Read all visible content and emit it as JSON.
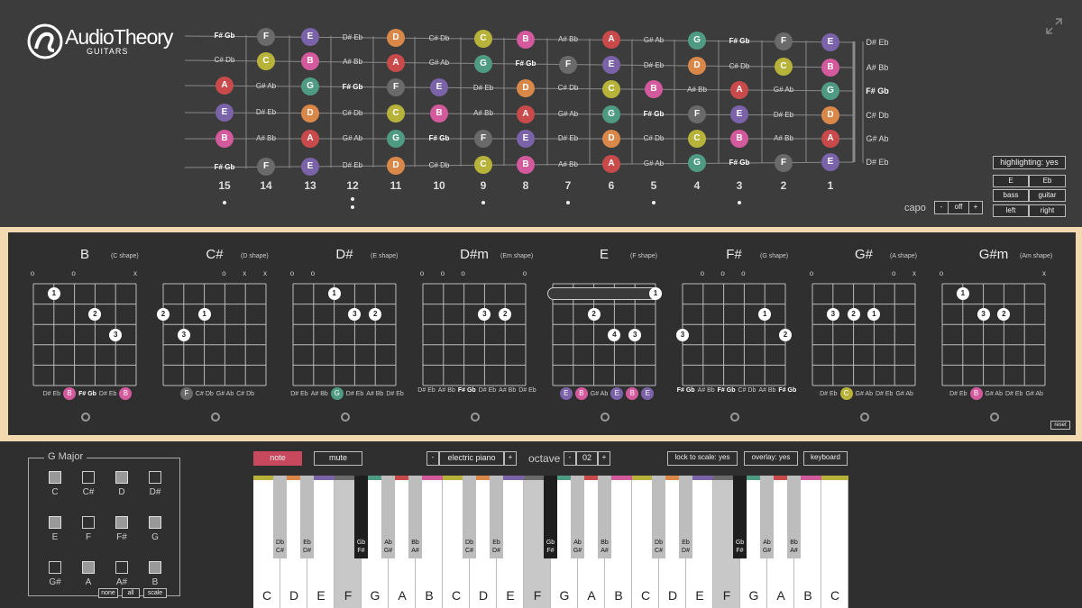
{
  "brand": {
    "name": "AudioTheory",
    "sub": "GUITARS"
  },
  "colors": {
    "A": "#c84a4a",
    "B": "#d35a9c",
    "C": "#b7b33a",
    "D": "#d9884a",
    "E": "#7a63a8",
    "F": "#6a6a6a",
    "G": "#4f9a82",
    "accent": "#f3d9b0",
    "note_button": "#c8485e"
  },
  "fretboard": {
    "fret_numbers": [
      "15",
      "14",
      "13",
      "12",
      "11",
      "10",
      "9",
      "8",
      "7",
      "6",
      "5",
      "4",
      "3",
      "2",
      "1"
    ],
    "right_labels": [
      "D# Eb",
      "A# Bb",
      "F# Gb",
      "C# Db",
      "G# Ab",
      "D# Eb"
    ],
    "strings": [
      [
        "F# Gb",
        "F",
        "E",
        "D# Eb",
        "D",
        "C# Db",
        "C",
        "B",
        "A# Bb",
        "A",
        "G# Ab",
        "G",
        "F# Gb",
        "F",
        "E"
      ],
      [
        "C# Db",
        "C",
        "B",
        "A# Bb",
        "A",
        "G# Ab",
        "G",
        "F# Gb",
        "F",
        "E",
        "D# Eb",
        "D",
        "C# Db",
        "C",
        "B"
      ],
      [
        "A",
        "G# Ab",
        "G",
        "F# Gb",
        "F",
        "E",
        "D# Eb",
        "D",
        "C# Db",
        "C",
        "B",
        "A# Bb",
        "A",
        "G# Ab",
        "G"
      ],
      [
        "E",
        "D# Eb",
        "D",
        "C# Db",
        "C",
        "B",
        "A# Bb",
        "A",
        "G# Ab",
        "G",
        "F# Gb",
        "F",
        "E",
        "D# Eb",
        "D"
      ],
      [
        "B",
        "A# Bb",
        "A",
        "G# Ab",
        "G",
        "F# Gb",
        "F",
        "E",
        "D# Eb",
        "D",
        "C# Db",
        "C",
        "B",
        "A# Bb",
        "A"
      ],
      [
        "F# Gb",
        "F",
        "E",
        "D# Eb",
        "D",
        "C# Db",
        "C",
        "B",
        "A# Bb",
        "A",
        "G# Ab",
        "G",
        "F# Gb",
        "F",
        "E"
      ]
    ]
  },
  "settings": {
    "highlighting": "highlighting: yes",
    "tuning_a": "E",
    "tuning_b": "Eb",
    "bass": "bass",
    "guitar": "guitar",
    "left": "left",
    "right": "right",
    "capo_label": "capo",
    "capo_minus": "-",
    "capo_value": "off",
    "capo_plus": "+"
  },
  "chords": [
    {
      "name": "B",
      "shape": "(C shape)",
      "open": [
        "o",
        "",
        "o",
        "",
        "",
        "x"
      ],
      "fingers": [
        [
          1,
          1,
          1
        ],
        [
          3,
          2,
          2
        ],
        [
          4,
          3,
          3
        ]
      ],
      "notes": [
        "D# Eb",
        "B",
        "F# Gb",
        "D# Eb",
        "B"
      ],
      "note_colors": [
        "",
        "B",
        "",
        "",
        "B"
      ]
    },
    {
      "name": "C#",
      "shape": "(D shape)",
      "open": [
        "",
        "",
        "",
        "o",
        "x",
        "x"
      ],
      "fingers": [
        [
          0,
          2,
          2
        ],
        [
          2,
          2,
          1
        ],
        [
          1,
          3,
          3
        ]
      ],
      "notes": [
        "F",
        "C# Db",
        "G# Ab",
        "C# Db"
      ],
      "note_colors": [
        "F",
        "",
        "",
        ""
      ]
    },
    {
      "name": "D#",
      "shape": "(E shape)",
      "open": [
        "o",
        "o",
        "",
        "",
        "",
        ""
      ],
      "fingers": [
        [
          2,
          1,
          1
        ],
        [
          3,
          2,
          3
        ],
        [
          4,
          2,
          2
        ]
      ],
      "notes": [
        "D# Eb",
        "A# Bb",
        "G",
        "D# Eb",
        "A# Bb",
        "D# Eb"
      ],
      "note_colors": [
        "",
        "",
        "G",
        "",
        "",
        ""
      ]
    },
    {
      "name": "D#m",
      "shape": "(Em shape)",
      "open": [
        "o",
        "o",
        "o",
        "",
        "",
        "o"
      ],
      "fingers": [
        [
          3,
          2,
          3
        ],
        [
          4,
          2,
          2
        ]
      ],
      "notes": [
        "D# Eb",
        "A# Bb",
        "F# Gb",
        "D# Eb",
        "A# Bb",
        "D# Eb"
      ],
      "note_colors": [
        "",
        "",
        "",
        "",
        "",
        ""
      ]
    },
    {
      "name": "E",
      "shape": "(F shape)",
      "open": [
        "",
        "",
        "",
        "",
        "",
        ""
      ],
      "fingers": [
        [
          5,
          1,
          1
        ],
        [
          2,
          2,
          2
        ],
        [
          3,
          3,
          4
        ],
        [
          4,
          3,
          3
        ]
      ],
      "notes": [
        "E",
        "B",
        "G# Ab",
        "E",
        "B",
        "E"
      ],
      "note_colors": [
        "E",
        "B",
        "",
        "E",
        "B",
        "E"
      ]
    },
    {
      "name": "F#",
      "shape": "(G shape)",
      "open": [
        "",
        "o",
        "o",
        "o",
        "",
        ""
      ],
      "fingers": [
        [
          4,
          2,
          1
        ],
        [
          0,
          3,
          3
        ],
        [
          5,
          3,
          2
        ]
      ],
      "notes": [
        "F# Gb",
        "A# Bb",
        "F# Gb",
        "C# Db",
        "A# Bb",
        "F# Gb"
      ],
      "note_colors": [
        "",
        "",
        "",
        "",
        "",
        ""
      ]
    },
    {
      "name": "G#",
      "shape": "(A shape)",
      "open": [
        "o",
        "",
        "",
        "",
        "o",
        "x"
      ],
      "fingers": [
        [
          1,
          2,
          3
        ],
        [
          2,
          2,
          2
        ],
        [
          3,
          2,
          1
        ]
      ],
      "notes": [
        "D# Eb",
        "C",
        "G# Ab",
        "D# Eb",
        "G# Ab"
      ],
      "note_colors": [
        "",
        "C",
        "",
        "",
        ""
      ]
    },
    {
      "name": "G#m",
      "shape": "(Am shape)",
      "open": [
        "o",
        "",
        "",
        "",
        "",
        "x"
      ],
      "fingers": [
        [
          1,
          1,
          1
        ],
        [
          2,
          2,
          3
        ],
        [
          3,
          2,
          2
        ]
      ],
      "notes": [
        "D# Eb",
        "B",
        "G# Ab",
        "D# Eb",
        "G# Ab"
      ],
      "note_colors": [
        "",
        "B",
        "",
        "",
        ""
      ]
    }
  ],
  "reset": "reset",
  "scale": {
    "title": "G Major",
    "notes": [
      {
        "n": "C",
        "on": true
      },
      {
        "n": "C#",
        "on": false
      },
      {
        "n": "D",
        "on": true
      },
      {
        "n": "D#",
        "on": false
      },
      {
        "n": "E",
        "on": true
      },
      {
        "n": "F",
        "on": false
      },
      {
        "n": "F#",
        "on": true
      },
      {
        "n": "G",
        "on": true
      },
      {
        "n": "G#",
        "on": false
      },
      {
        "n": "A",
        "on": true
      },
      {
        "n": "A#",
        "on": false
      },
      {
        "n": "B",
        "on": true
      }
    ],
    "none": "none",
    "all": "all",
    "scale_btn": "scale"
  },
  "keyboard_bar": {
    "note": "note",
    "mute": "mute",
    "inst_minus": "-",
    "instrument": "electric piano",
    "inst_plus": "+",
    "octave_label": "octave",
    "oct_minus": "-",
    "octave": "02",
    "oct_plus": "+",
    "lock": "lock to scale: yes",
    "overlay": "overlay: yes",
    "keyboard": "keyboard"
  },
  "piano": {
    "white": [
      "C",
      "D",
      "E",
      "F",
      "G",
      "A",
      "B",
      "C",
      "D",
      "E",
      "F",
      "G",
      "A",
      "B",
      "C",
      "D",
      "E",
      "F",
      "G",
      "A",
      "B",
      "C"
    ],
    "white_hl": [
      3,
      10,
      17
    ],
    "black": [
      [
        "Db",
        "C#"
      ],
      [
        "Eb",
        "D#"
      ],
      [
        "Gb",
        "F#"
      ],
      [
        "Ab",
        "G#"
      ],
      [
        "Bb",
        "A#"
      ],
      [
        "Db",
        "C#"
      ],
      [
        "Eb",
        "D#"
      ],
      [
        "Gb",
        "F#"
      ],
      [
        "Ab",
        "G#"
      ],
      [
        "Bb",
        "A#"
      ],
      [
        "Db",
        "C#"
      ],
      [
        "Eb",
        "D#"
      ],
      [
        "Gb",
        "F#"
      ],
      [
        "Ab",
        "G#"
      ],
      [
        "Bb",
        "A#"
      ]
    ]
  }
}
